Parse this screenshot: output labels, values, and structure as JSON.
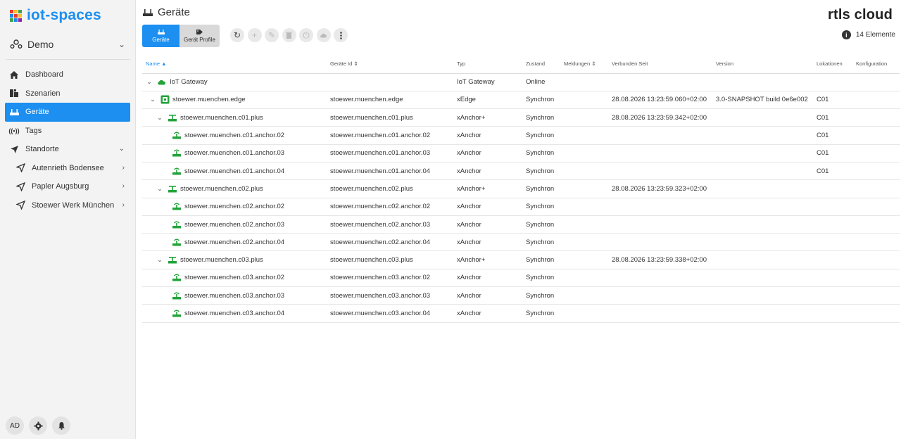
{
  "app": {
    "logo_text": "iot-spaces",
    "brand": "rtls cloud"
  },
  "org": {
    "name": "Demo"
  },
  "nav": {
    "items": [
      {
        "label": "Dashboard"
      },
      {
        "label": "Szenarien"
      },
      {
        "label": "Geräte"
      },
      {
        "label": "Tags"
      },
      {
        "label": "Standorte"
      },
      {
        "label": "Autenrieth Bodensee"
      },
      {
        "label": "Papler Augsburg"
      },
      {
        "label": "Stoewer Werk München"
      }
    ]
  },
  "footer": {
    "avatar": "AD"
  },
  "page": {
    "title": "Geräte",
    "count_label": "14 Elemente"
  },
  "tabs": [
    {
      "label": "Geräte"
    },
    {
      "label": "Gerät Profile"
    }
  ],
  "table": {
    "headers": {
      "name": "Name",
      "id": "Geräte Id",
      "typ": "Typ",
      "zustand": "Zustand",
      "meldungen": "Meldungen",
      "verbunden": "Verbunden Seit",
      "version": "Version",
      "lokationen": "Lokationen",
      "konfiguration": "Konfiguration"
    },
    "rows": [
      {
        "name": "IoT Gateway",
        "id": "",
        "typ": "IoT Gateway",
        "zustand": "Online",
        "meldungen": "",
        "verbunden": "",
        "version": "",
        "lokationen": "",
        "konfiguration": ""
      },
      {
        "name": "stoewer.muenchen.edge",
        "id": "stoewer.muenchen.edge",
        "typ": "xEdge",
        "zustand": "Synchron",
        "meldungen": "",
        "verbunden": "28.08.2026 13:23:59.060+02:00",
        "version": "3.0-SNAPSHOT build 0e6e002",
        "lokationen": "C01",
        "konfiguration": ""
      },
      {
        "name": "stoewer.muenchen.c01.plus",
        "id": "stoewer.muenchen.c01.plus",
        "typ": "xAnchor+",
        "zustand": "Synchron",
        "meldungen": "",
        "verbunden": "28.08.2026 13:23:59.342+02:00",
        "version": "",
        "lokationen": "C01",
        "konfiguration": ""
      },
      {
        "name": "stoewer.muenchen.c01.anchor.02",
        "id": "stoewer.muenchen.c01.anchor.02",
        "typ": "xAnchor",
        "zustand": "Synchron",
        "meldungen": "",
        "verbunden": "",
        "version": "",
        "lokationen": "C01",
        "konfiguration": ""
      },
      {
        "name": "stoewer.muenchen.c01.anchor.03",
        "id": "stoewer.muenchen.c01.anchor.03",
        "typ": "xAnchor",
        "zustand": "Synchron",
        "meldungen": "",
        "verbunden": "",
        "version": "",
        "lokationen": "C01",
        "konfiguration": ""
      },
      {
        "name": "stoewer.muenchen.c01.anchor.04",
        "id": "stoewer.muenchen.c01.anchor.04",
        "typ": "xAnchor",
        "zustand": "Synchron",
        "meldungen": "",
        "verbunden": "",
        "version": "",
        "lokationen": "C01",
        "konfiguration": ""
      },
      {
        "name": "stoewer.muenchen.c02.plus",
        "id": "stoewer.muenchen.c02.plus",
        "typ": "xAnchor+",
        "zustand": "Synchron",
        "meldungen": "",
        "verbunden": "28.08.2026 13:23:59.323+02:00",
        "version": "",
        "lokationen": "",
        "konfiguration": ""
      },
      {
        "name": "stoewer.muenchen.c02.anchor.02",
        "id": "stoewer.muenchen.c02.anchor.02",
        "typ": "xAnchor",
        "zustand": "Synchron",
        "meldungen": "",
        "verbunden": "",
        "version": "",
        "lokationen": "",
        "konfiguration": ""
      },
      {
        "name": "stoewer.muenchen.c02.anchor.03",
        "id": "stoewer.muenchen.c02.anchor.03",
        "typ": "xAnchor",
        "zustand": "Synchron",
        "meldungen": "",
        "verbunden": "",
        "version": "",
        "lokationen": "",
        "konfiguration": ""
      },
      {
        "name": "stoewer.muenchen.c02.anchor.04",
        "id": "stoewer.muenchen.c02.anchor.04",
        "typ": "xAnchor",
        "zustand": "Synchron",
        "meldungen": "",
        "verbunden": "",
        "version": "",
        "lokationen": "",
        "konfiguration": ""
      },
      {
        "name": "stoewer.muenchen.c03.plus",
        "id": "stoewer.muenchen.c03.plus",
        "typ": "xAnchor+",
        "zustand": "Synchron",
        "meldungen": "",
        "verbunden": "28.08.2026 13:23:59.338+02:00",
        "version": "",
        "lokationen": "",
        "konfiguration": ""
      },
      {
        "name": "stoewer.muenchen.c03.anchor.02",
        "id": "stoewer.muenchen.c03.anchor.02",
        "typ": "xAnchor",
        "zustand": "Synchron",
        "meldungen": "",
        "verbunden": "",
        "version": "",
        "lokationen": "",
        "konfiguration": ""
      },
      {
        "name": "stoewer.muenchen.c03.anchor.03",
        "id": "stoewer.muenchen.c03.anchor.03",
        "typ": "xAnchor",
        "zustand": "Synchron",
        "meldungen": "",
        "verbunden": "",
        "version": "",
        "lokationen": "",
        "konfiguration": ""
      },
      {
        "name": "stoewer.muenchen.c03.anchor.04",
        "id": "stoewer.muenchen.c03.anchor.04",
        "typ": "xAnchor",
        "zustand": "Synchron",
        "meldungen": "",
        "verbunden": "",
        "version": "",
        "lokationen": "",
        "konfiguration": ""
      }
    ]
  },
  "colors": {
    "accent": "#1c8ff0",
    "device_green": "#22a33a"
  }
}
